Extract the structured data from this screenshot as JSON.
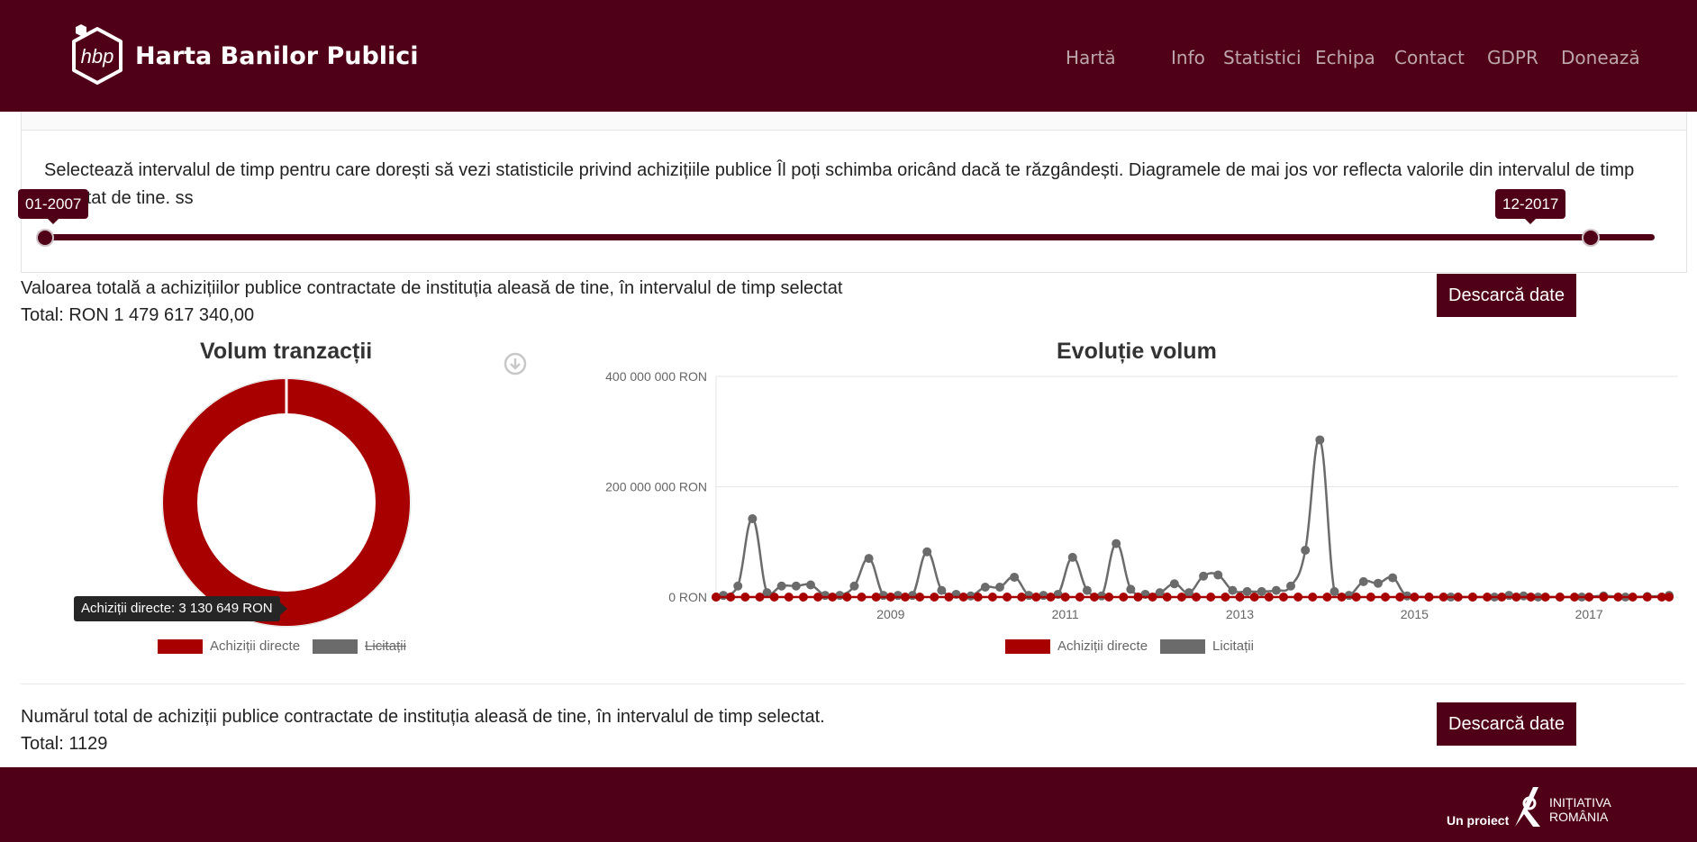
{
  "brand": {
    "logo_text": "hbp",
    "title": "Harta Banilor Publici"
  },
  "nav": [
    {
      "label": "Hartă"
    },
    {
      "label": "Info"
    },
    {
      "label": "Statistici"
    },
    {
      "label": "Echipa"
    },
    {
      "label": "Contact"
    },
    {
      "label": "GDPR"
    },
    {
      "label": "Donează"
    }
  ],
  "range": {
    "description": "Selectează intervalul de timp pentru care dorești să vezi statisticile privind achizițiile publice Îl poți schimba oricând dacă te răzgândești. Diagramele de mai jos vor reflecta valorile din intervalul de timp selectat de tine. ss",
    "start_label": "01-2007",
    "end_label": "12-2017",
    "start_fraction": 0.0,
    "end_fraction": 0.96
  },
  "value_section": {
    "text": "Valoarea totală a achizițiilor publice contractate de instituția aleasă de tine, în intervalul de timp selectat",
    "total": "Total: RON 1 479 617 340,00",
    "download_label": "Descarcă date"
  },
  "count_section": {
    "text": "Numărul total de achiziții publice contractate de instituția aleasă de tine, în intervalul de timp selectat.",
    "total": "Total: 1129",
    "download_label": "Descarcă date"
  },
  "footer": {
    "text": "Un proiect",
    "org_line1": "INIȚIATIVA",
    "org_line2": "ROMÂNIA"
  },
  "colors": {
    "brand": "#4f0018",
    "direct": "#a80000",
    "licitatii": "#6b6b6b"
  },
  "icons": {
    "download_chart": "download-circle-icon"
  },
  "chart_data": [
    {
      "type": "pie",
      "title": "Volum tranzacții",
      "labels": [
        "Achiziții directe",
        "Licitații"
      ],
      "legend": [
        {
          "name": "Achiziții directe",
          "hidden": false
        },
        {
          "name": "Licitații",
          "hidden": true
        }
      ],
      "values": [
        3130649
      ],
      "tooltip": "Achiziții directe: 3 130 649 RON"
    },
    {
      "type": "line",
      "title": "Evoluție volum",
      "x_ticks": [
        "2009",
        "2011",
        "2013",
        "2015",
        "2017"
      ],
      "y_ticks": [
        "400 000 000 RON",
        "200 000 000 RON",
        "0 RON"
      ],
      "ylim": [
        0,
        400000000
      ],
      "xlim": [
        "2007-01",
        "2017-12"
      ],
      "legend_position": "bottom",
      "series": [
        {
          "name": "Achiziții directe",
          "color": "#a80000",
          "points": [
            [
              "2007-01",
              0
            ],
            [
              "2007-03",
              0
            ],
            [
              "2007-05",
              0
            ],
            [
              "2007-07",
              0
            ],
            [
              "2007-09",
              0
            ],
            [
              "2007-11",
              0
            ],
            [
              "2008-01",
              0
            ],
            [
              "2008-03",
              0
            ],
            [
              "2008-05",
              0
            ],
            [
              "2008-07",
              0
            ],
            [
              "2008-09",
              0
            ],
            [
              "2008-11",
              0
            ],
            [
              "2009-01",
              0
            ],
            [
              "2009-03",
              0
            ],
            [
              "2009-05",
              0
            ],
            [
              "2009-07",
              0
            ],
            [
              "2009-09",
              0
            ],
            [
              "2009-11",
              0
            ],
            [
              "2010-01",
              0
            ],
            [
              "2010-03",
              0
            ],
            [
              "2010-05",
              0
            ],
            [
              "2010-07",
              0
            ],
            [
              "2010-09",
              0
            ],
            [
              "2010-11",
              0
            ],
            [
              "2011-01",
              0
            ],
            [
              "2011-03",
              0
            ],
            [
              "2011-05",
              0
            ],
            [
              "2011-07",
              0
            ],
            [
              "2011-09",
              0
            ],
            [
              "2011-11",
              0
            ],
            [
              "2012-01",
              0
            ],
            [
              "2012-03",
              0
            ],
            [
              "2012-05",
              0
            ],
            [
              "2012-07",
              0
            ],
            [
              "2012-09",
              0
            ],
            [
              "2012-11",
              0
            ],
            [
              "2013-01",
              0
            ],
            [
              "2013-03",
              0
            ],
            [
              "2013-05",
              0
            ],
            [
              "2013-07",
              0
            ],
            [
              "2013-09",
              0
            ],
            [
              "2013-11",
              0
            ],
            [
              "2014-01",
              0
            ],
            [
              "2014-03",
              0
            ],
            [
              "2014-05",
              0
            ],
            [
              "2014-07",
              0
            ],
            [
              "2014-09",
              0
            ],
            [
              "2014-11",
              0
            ],
            [
              "2015-01",
              0
            ],
            [
              "2015-03",
              0
            ],
            [
              "2015-05",
              0
            ],
            [
              "2015-07",
              0
            ],
            [
              "2015-09",
              0
            ],
            [
              "2015-11",
              0
            ],
            [
              "2016-01",
              0
            ],
            [
              "2016-03",
              0
            ],
            [
              "2016-05",
              0
            ],
            [
              "2016-07",
              0
            ],
            [
              "2016-09",
              0
            ],
            [
              "2016-11",
              0
            ],
            [
              "2017-01",
              0
            ],
            [
              "2017-03",
              0
            ],
            [
              "2017-05",
              0
            ],
            [
              "2017-07",
              0
            ],
            [
              "2017-09",
              0
            ],
            [
              "2017-11",
              0
            ],
            [
              "2017-12",
              0
            ]
          ]
        },
        {
          "name": "Licitații",
          "color": "#6b6b6b",
          "points": [
            [
              "2007-01",
              0
            ],
            [
              "2007-02",
              3000000
            ],
            [
              "2007-04",
              20000000
            ],
            [
              "2007-06",
              142000000
            ],
            [
              "2007-08",
              8000000
            ],
            [
              "2007-10",
              20000000
            ],
            [
              "2007-12",
              20000000
            ],
            [
              "2008-02",
              22000000
            ],
            [
              "2008-04",
              3000000
            ],
            [
              "2008-06",
              3000000
            ],
            [
              "2008-08",
              20000000
            ],
            [
              "2008-10",
              70000000
            ],
            [
              "2008-12",
              3000000
            ],
            [
              "2009-02",
              3000000
            ],
            [
              "2009-04",
              3000000
            ],
            [
              "2009-06",
              82000000
            ],
            [
              "2009-08",
              12000000
            ],
            [
              "2009-10",
              5000000
            ],
            [
              "2009-12",
              2000000
            ],
            [
              "2010-02",
              18000000
            ],
            [
              "2010-04",
              18000000
            ],
            [
              "2010-06",
              36000000
            ],
            [
              "2010-08",
              3000000
            ],
            [
              "2010-10",
              3000000
            ],
            [
              "2010-12",
              5000000
            ],
            [
              "2011-02",
              72000000
            ],
            [
              "2011-04",
              12000000
            ],
            [
              "2011-06",
              2000000
            ],
            [
              "2011-08",
              97000000
            ],
            [
              "2011-10",
              14000000
            ],
            [
              "2011-12",
              5000000
            ],
            [
              "2012-02",
              8000000
            ],
            [
              "2012-04",
              24000000
            ],
            [
              "2012-06",
              8000000
            ],
            [
              "2012-08",
              38000000
            ],
            [
              "2012-10",
              40000000
            ],
            [
              "2012-12",
              12000000
            ],
            [
              "2013-02",
              10000000
            ],
            [
              "2013-04",
              10000000
            ],
            [
              "2013-06",
              12000000
            ],
            [
              "2013-08",
              20000000
            ],
            [
              "2013-10",
              85000000
            ],
            [
              "2013-12",
              285000000
            ],
            [
              "2014-02",
              10000000
            ],
            [
              "2014-04",
              3000000
            ],
            [
              "2014-06",
              28000000
            ],
            [
              "2014-08",
              25000000
            ],
            [
              "2014-10",
              35000000
            ],
            [
              "2014-12",
              2000000
            ],
            [
              "2015-03",
              0
            ],
            [
              "2015-06",
              0
            ],
            [
              "2015-09",
              0
            ],
            [
              "2015-12",
              0
            ],
            [
              "2016-02",
              3000000
            ],
            [
              "2016-04",
              2000000
            ],
            [
              "2016-06",
              0
            ],
            [
              "2016-09",
              0
            ],
            [
              "2016-12",
              0
            ],
            [
              "2017-03",
              2000000
            ],
            [
              "2017-06",
              0
            ],
            [
              "2017-09",
              1000000
            ],
            [
              "2017-12",
              3000000
            ]
          ]
        }
      ]
    }
  ]
}
